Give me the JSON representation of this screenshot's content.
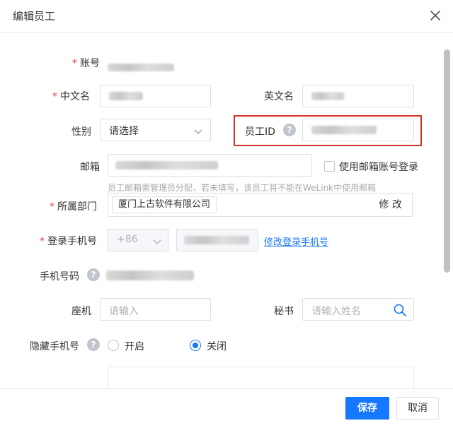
{
  "dialog": {
    "title": "编辑员工"
  },
  "form": {
    "required_mark": "*",
    "account": {
      "label": "账号"
    },
    "chinese_name": {
      "label": "中文名"
    },
    "english_name": {
      "label": "英文名"
    },
    "gender": {
      "label": "性别",
      "placeholder": "请选择"
    },
    "employee_id": {
      "label": "员工ID",
      "help": "?"
    },
    "email": {
      "label": "邮箱",
      "use_email_login_label": "使用邮箱账号登录",
      "use_email_login_checked": false,
      "hint": "员工邮箱需管理员分配，若未填写，该员工将不能在WeLink中使用邮箱"
    },
    "department": {
      "label": "所属部门",
      "value": "厦门上古软件有限公司",
      "modify_label": "修 改"
    },
    "login_phone": {
      "label": "登录手机号",
      "country_code": "+86",
      "change_link": "修改登录手机号"
    },
    "mobile": {
      "label": "手机号码",
      "help": "?"
    },
    "landline": {
      "label": "座机",
      "placeholder": "请输入"
    },
    "secretary": {
      "label": "秘书",
      "placeholder": "请输入姓名"
    },
    "hide_phone": {
      "label": "隐藏手机号",
      "help": "?",
      "options": [
        {
          "label": "开启",
          "checked": false
        },
        {
          "label": "关闭",
          "checked": true
        }
      ]
    }
  },
  "footer": {
    "save_label": "保存",
    "cancel_label": "取消"
  },
  "colors": {
    "primary": "#1677ff",
    "required": "#e4393c",
    "highlight_border": "#d93025"
  }
}
